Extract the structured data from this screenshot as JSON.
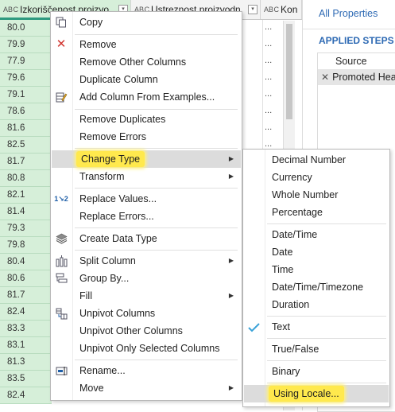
{
  "grid": {
    "columns": [
      {
        "type_icon": "A B C",
        "label": "Izkoriščenost proizvo"
      },
      {
        "type_icon": "A B C",
        "label": "Ustreznost proizvodn"
      },
      {
        "type_icon": "A B C",
        "label": "Kon"
      }
    ],
    "values": [
      "80.0",
      "79.9",
      "77.9",
      "79.6",
      "79.1",
      "78.6",
      "81.6",
      "82.5",
      "81.7",
      "80.8",
      "82.1",
      "81.4",
      "79.3",
      "79.8",
      "80.4",
      "80.6",
      "81.7",
      "82.4",
      "83.3",
      "83.1",
      "81.3",
      "83.5",
      "82.4"
    ],
    "ellipsis": "..."
  },
  "query_settings": {
    "all_properties": "All Properties",
    "applied_steps": "APPLIED STEPS",
    "steps": [
      "Source",
      "Promoted Headers"
    ]
  },
  "context_menu": {
    "items": {
      "copy": "Copy",
      "remove": "Remove",
      "remove_other": "Remove Other Columns",
      "duplicate": "Duplicate Column",
      "add_from_examples": "Add Column From Examples...",
      "remove_duplicates": "Remove Duplicates",
      "remove_errors": "Remove Errors",
      "change_type": "Change Type",
      "transform": "Transform",
      "replace_values": "Replace Values...",
      "replace_errors": "Replace Errors...",
      "create_data_type": "Create Data Type",
      "split_column": "Split Column",
      "group_by": "Group By...",
      "fill": "Fill",
      "unpivot": "Unpivot Columns",
      "unpivot_other": "Unpivot Other Columns",
      "unpivot_selected": "Unpivot Only Selected Columns",
      "rename": "Rename...",
      "move": "Move"
    }
  },
  "type_submenu": {
    "items": {
      "decimal": "Decimal Number",
      "currency": "Currency",
      "whole": "Whole Number",
      "percentage": "Percentage",
      "datetime": "Date/Time",
      "date": "Date",
      "time": "Time",
      "datetimezone": "Date/Time/Timezone",
      "duration": "Duration",
      "text": "Text",
      "truefalse": "True/False",
      "binary": "Binary",
      "locale": "Using Locale..."
    },
    "checked": "Text"
  },
  "colors": {
    "selected_column_bg": "#d6efd9",
    "accent_blue": "#2e6ab4",
    "highlight_yellow": "#ffe94d"
  }
}
